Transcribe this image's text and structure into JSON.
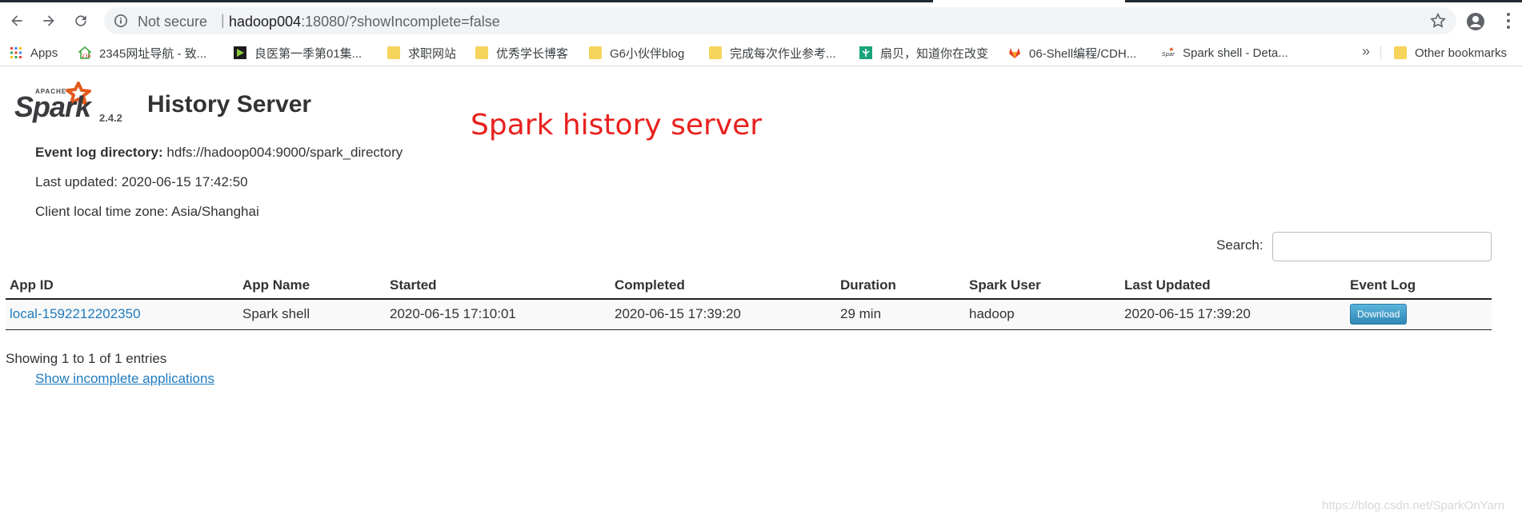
{
  "browser": {
    "address_security": "Not secure",
    "address_separator": "|",
    "url_host": "hadoop004",
    "url_rest": ":18080/?showIncomplete=false",
    "bookmarks": [
      {
        "label": "Apps",
        "icon": "apps-grid-icon"
      },
      {
        "label": "2345网址导航 - 致...",
        "icon": "2345-site-icon"
      },
      {
        "label": "良医第一季第01集...",
        "icon": "video-site-icon"
      },
      {
        "label": "求职网站",
        "icon": "folder-icon"
      },
      {
        "label": "优秀学长博客",
        "icon": "folder-icon"
      },
      {
        "label": "G6小伙伴blog",
        "icon": "folder-icon"
      },
      {
        "label": "完成每次作业参考...",
        "icon": "folder-icon"
      },
      {
        "label": "扇贝，知道你在改变",
        "icon": "shanbay-icon"
      },
      {
        "label": "06-Shell编程/CDH...",
        "icon": "gitlab-icon"
      },
      {
        "label": "Spark shell - Deta...",
        "icon": "spark-icon"
      }
    ],
    "bookmarks_overflow": "»",
    "other_bookmarks": "Other bookmarks"
  },
  "header": {
    "logo_text": "Spark",
    "logo_small": "APACHE",
    "version": "2.4.2",
    "title": "History Server"
  },
  "annotation": "Spark history server",
  "info": {
    "event_log_label": "Event log directory:",
    "event_log_value": "hdfs://hadoop004:9000/spark_directory",
    "last_updated": "Last updated: 2020-06-15 17:42:50",
    "time_zone": "Client local time zone: Asia/Shanghai"
  },
  "search": {
    "label": "Search:",
    "value": ""
  },
  "table": {
    "headers": [
      "App ID",
      "App Name",
      "Started",
      "Completed",
      "Duration",
      "Spark User",
      "Last Updated",
      "Event Log"
    ],
    "rows": [
      {
        "app_id": "local-1592212202350",
        "app_name": "Spark shell",
        "started": "2020-06-15 17:10:01",
        "completed": "2020-06-15 17:39:20",
        "duration": "29 min",
        "user": "hadoop",
        "last_updated": "2020-06-15 17:39:20",
        "event_log": "Download"
      }
    ]
  },
  "footer": {
    "showing": "Showing 1 to 1 of 1 entries",
    "toggle": "Show incomplete applications"
  },
  "watermark": "https://blog.csdn.net/SparkOnYarn",
  "colors": {
    "link": "#1f7bbf",
    "annotation": "#e8211e",
    "button": "#3a96c2"
  }
}
